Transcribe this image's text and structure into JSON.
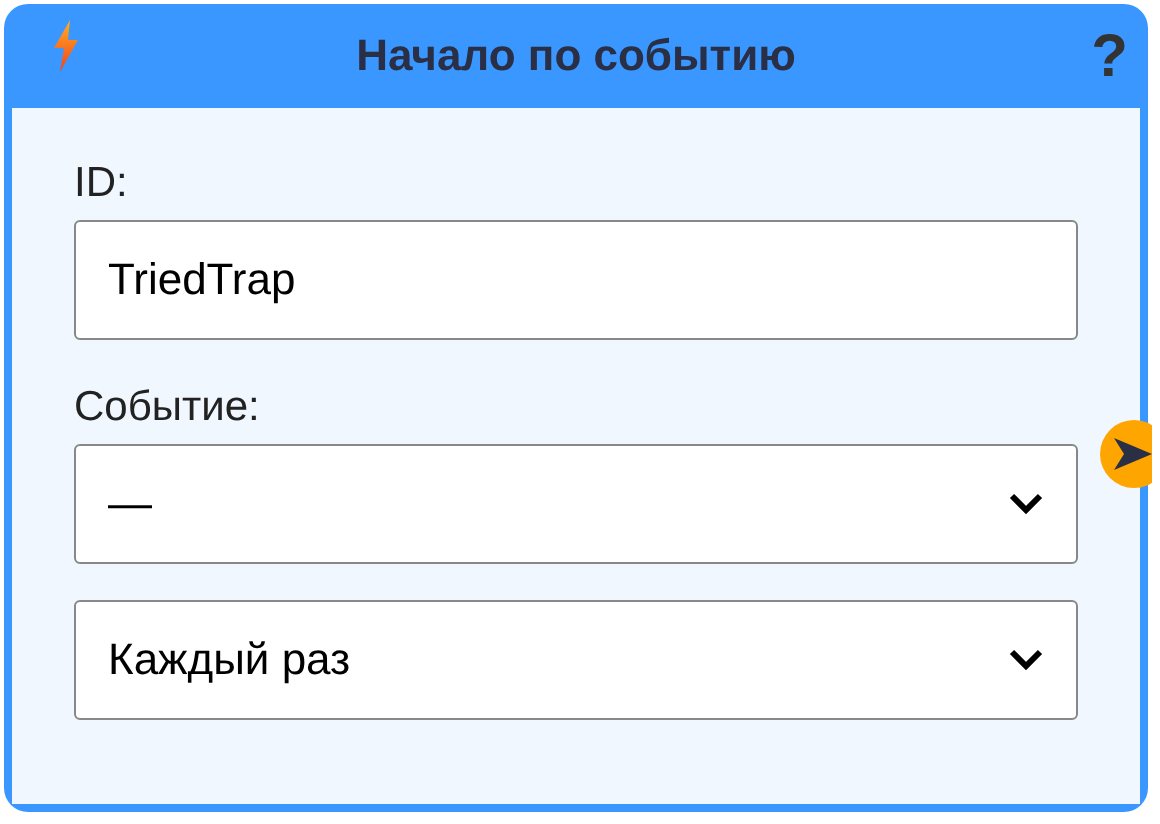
{
  "node": {
    "title": "Начало по событию",
    "help": "?"
  },
  "id_field": {
    "label": "ID:",
    "value": "TriedTrap"
  },
  "event_field": {
    "label": "Событие:",
    "value": "—"
  },
  "repeat_select": {
    "value": "Каждый раз"
  }
}
